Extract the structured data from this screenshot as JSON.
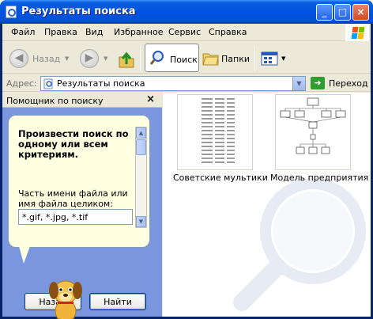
{
  "window": {
    "title": "Результаты поиска",
    "buttons": {
      "minimize": "_",
      "maximize": "□",
      "close": "×"
    }
  },
  "menu": {
    "items": [
      "Файл",
      "Правка",
      "Вид",
      "Избранное",
      "Сервис",
      "Справка"
    ]
  },
  "toolbar": {
    "back_label": "Назад",
    "search_label": "Поиск",
    "folders_label": "Папки"
  },
  "address": {
    "label": "Адрес:",
    "value": "Результаты поиска",
    "go_label": "Переход"
  },
  "search_pane": {
    "title": "Помощник по поиску",
    "close_glyph": "×",
    "heading": "Произвести поиск по одному или всем критериям.",
    "field_label": "Часть имени файла или имя файла целиком:",
    "field_value": "*.gif, *.jpg, *.tif",
    "back_button": "Назад",
    "find_button": "Найти"
  },
  "results": {
    "items": [
      {
        "name": "Советские мультики"
      },
      {
        "name": "Модель предприятия"
      }
    ]
  },
  "colors": {
    "titlebar": "#0054e3",
    "pane_background": "#7a96df",
    "balloon": "#ffffe1",
    "window_chrome": "#ece9d8"
  }
}
